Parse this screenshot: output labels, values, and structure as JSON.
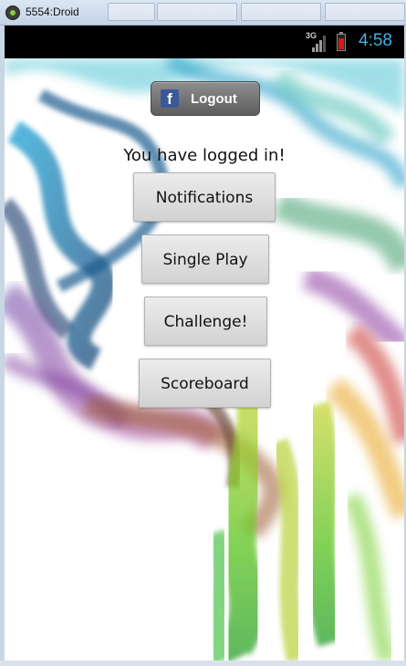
{
  "window": {
    "title": "5554:Droid"
  },
  "statusbar": {
    "network": "3G",
    "time": "4:58"
  },
  "app": {
    "logout_label": "Logout",
    "status_message": "You have logged in!",
    "buttons": {
      "notifications": "Notifications",
      "single_play": "Single Play",
      "challenge": "Challenge!",
      "scoreboard": "Scoreboard"
    }
  },
  "colors": {
    "clock": "#3eb1e6",
    "facebook": "#3b5998",
    "battery_low": "#d11c1c"
  },
  "icons": [
    "android-emulator-icon",
    "signal-icon",
    "battery-icon",
    "facebook-icon"
  ]
}
